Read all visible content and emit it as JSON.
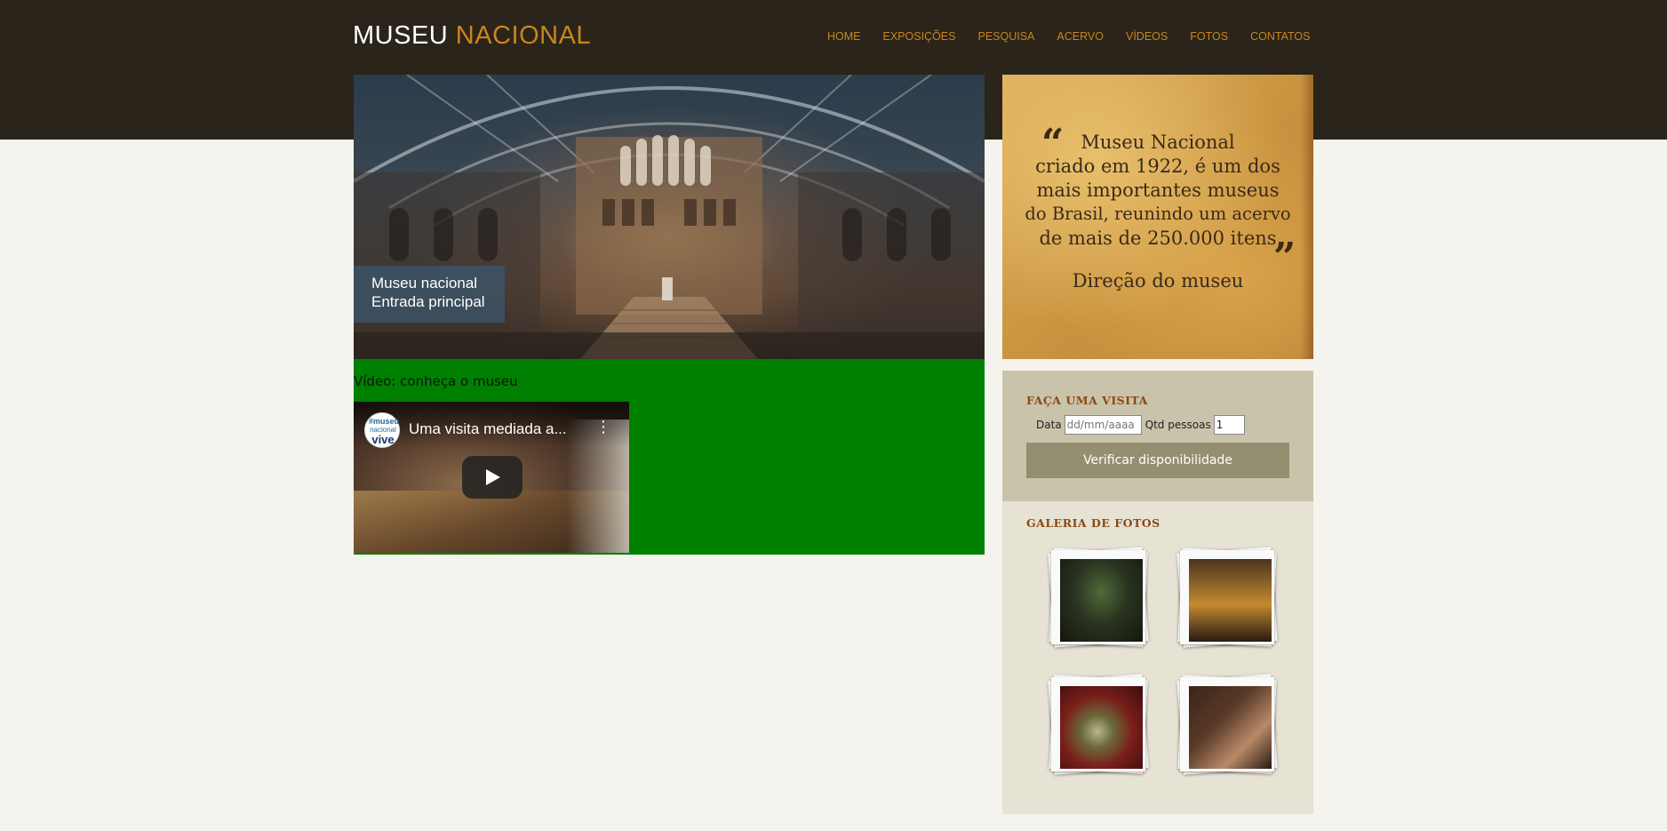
{
  "site": {
    "logo_part1": "MUSEU",
    "logo_part2": "NACIONAL"
  },
  "nav": {
    "items": [
      "HOME",
      "EXPOSIÇÕES",
      "PESQUISA",
      "ACERVO",
      "VÍDEOS",
      "FOTOS",
      "CONTATOS"
    ]
  },
  "hero": {
    "caption_line1": "Museu nacional",
    "caption_line2": "Entrada principal"
  },
  "video": {
    "section_title": "Vídeo: conheça o museu",
    "player_title": "Uma visita mediada a...",
    "channel_line1": "#museu",
    "channel_line2": "nacional",
    "channel_line3": "vive"
  },
  "quote": {
    "lines": [
      "Museu Nacional",
      "criado em 1922, é um dos",
      "mais importantes museus",
      "do Brasil, reunindo um acervo",
      "de mais de 250.000 itens"
    ],
    "open_mark": "“",
    "close_mark": "”",
    "author": "Direção do museu"
  },
  "visit": {
    "title": "FAÇA UMA VISITA",
    "date_label": "Data",
    "date_placeholder": "dd/mm/aaaa",
    "qty_label": "Qtd pessoas",
    "qty_value": "1",
    "button_label": "Verificar disponibilidade"
  },
  "gallery": {
    "title": "GALERIA DE FOTOS"
  },
  "colors": {
    "topbar": "#2a241a",
    "accent": "#c8861d",
    "video_bg": "#008000",
    "button": "#958f72"
  }
}
